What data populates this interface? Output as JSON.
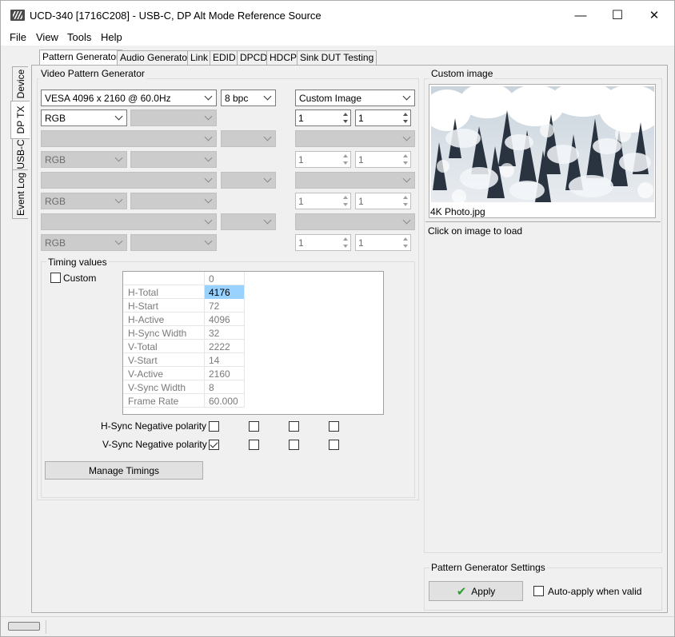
{
  "window": {
    "title": "UCD-340 [1716C208] - USB-C, DP Alt Mode Reference Source",
    "minimize_glyph": "—",
    "maximize_glyph": "☐",
    "close_glyph": "✕"
  },
  "menu": {
    "items": [
      "File",
      "View",
      "Tools",
      "Help"
    ]
  },
  "side_tabs": [
    "Device",
    "DP TX",
    "USB-C",
    "Event Log"
  ],
  "tabs": [
    "Pattern Generator",
    "Audio Generator",
    "Link",
    "EDID",
    "DPCD",
    "HDCP",
    "Sink DUT Testing"
  ],
  "video_pattern_generator": {
    "label": "Video Pattern Generator",
    "resolution": "VESA 4096 x 2160 @ 60.0Hz",
    "bpc": "8 bpc",
    "pattern": "Custom Image",
    "color_format": "RGB",
    "spin_h": "1",
    "spin_v": "1",
    "disabled_color_format": "RGB",
    "disabled_spin_value": "1"
  },
  "timing": {
    "label": "Timing values",
    "custom_label": "Custom",
    "column_header": "0",
    "rows": [
      {
        "name": "H-Total",
        "value": "4176"
      },
      {
        "name": "H-Start",
        "value": "72"
      },
      {
        "name": "H-Active",
        "value": "4096"
      },
      {
        "name": "H-Sync Width",
        "value": "32"
      },
      {
        "name": "V-Total",
        "value": "2222"
      },
      {
        "name": "V-Start",
        "value": "14"
      },
      {
        "name": "V-Active",
        "value": "2160"
      },
      {
        "name": "V-Sync Width",
        "value": "8"
      },
      {
        "name": "Frame Rate",
        "value": "60.000"
      }
    ],
    "hsync_label": "H-Sync Negative polarity",
    "vsync_label": "V-Sync Negative polarity",
    "manage_button": "Manage Timings"
  },
  "custom_image": {
    "label": "Custom image",
    "filename": "4K Photo.jpg",
    "hint": "Click on image to load"
  },
  "settings": {
    "label": "Pattern Generator Settings",
    "apply_button": "Apply",
    "auto_apply_label": "Auto-apply when valid",
    "apply_check_glyph": "✔",
    "accent_color": "#2f9e2f"
  }
}
